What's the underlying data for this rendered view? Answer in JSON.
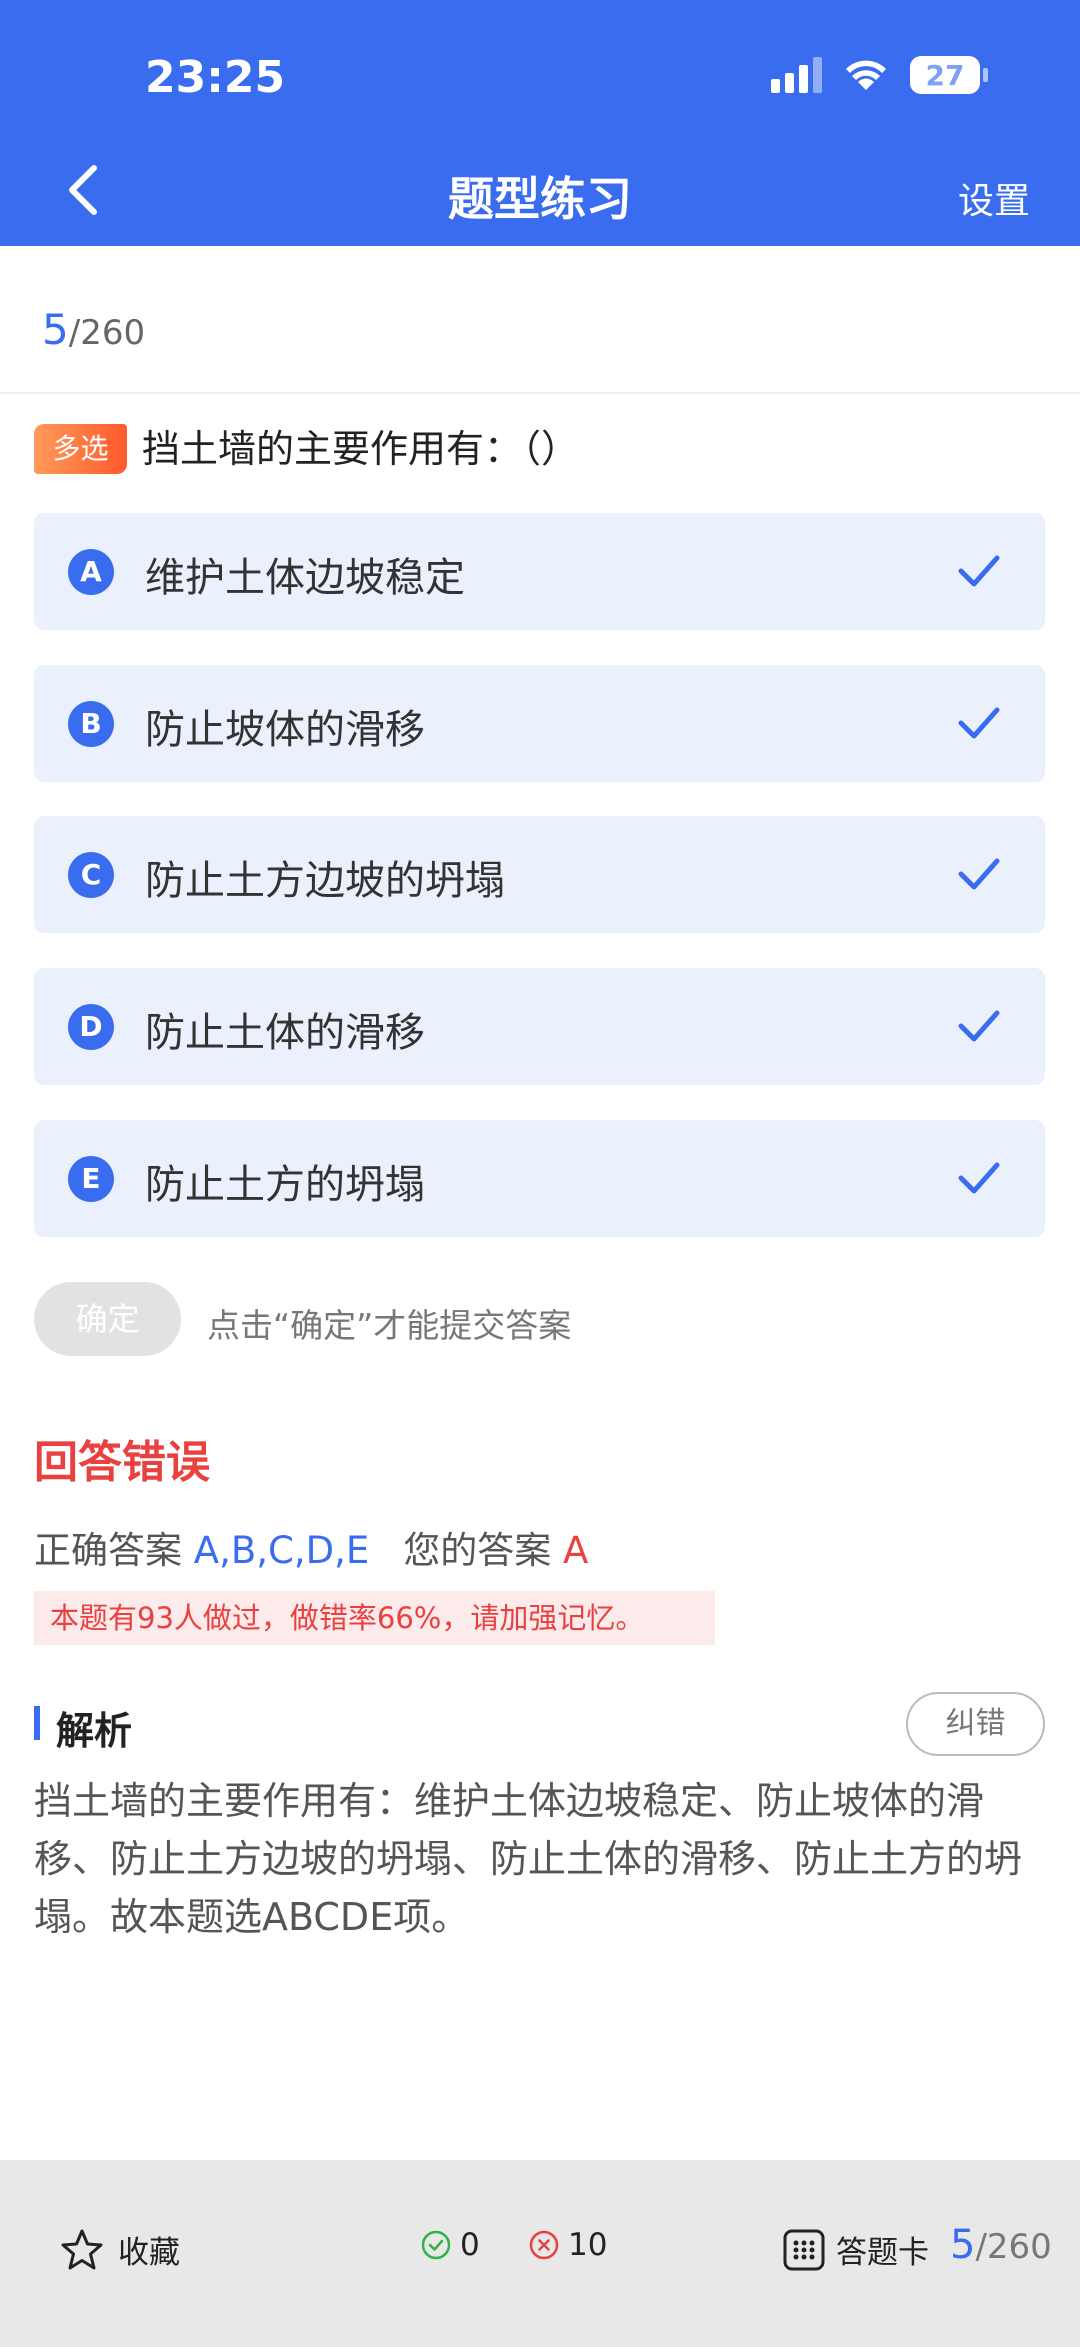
{
  "status": {
    "time": "23:25",
    "battery": "27"
  },
  "nav": {
    "title": "题型练习",
    "settings": "设置"
  },
  "progress": {
    "current": "5",
    "total": "/260"
  },
  "question": {
    "type": "多选",
    "text": "挡土墙的主要作用有：（）",
    "options": [
      {
        "letter": "A",
        "text": "维护土体边坡稳定"
      },
      {
        "letter": "B",
        "text": "防止坡体的滑移"
      },
      {
        "letter": "C",
        "text": "防止土方边坡的坍塌"
      },
      {
        "letter": "D",
        "text": "防止土体的滑移"
      },
      {
        "letter": "E",
        "text": "防止土方的坍塌"
      }
    ]
  },
  "confirm": {
    "label": "确定",
    "hint": "点击“确定”才能提交答案"
  },
  "result": {
    "title": "回答错误",
    "correct_label": "正确答案",
    "correct_value": "A,B,C,D,E",
    "mine_label": "您的答案",
    "mine_value": "A",
    "stat": "本题有93人做过，做错率66%，请加强记忆。"
  },
  "analysis": {
    "title": "解析",
    "correct_error": "纠错",
    "text": "挡土墙的主要作用有：维护土体边坡稳定、防止坡体的滑移、防止土方边坡的坍塌、防止土体的滑移、防止土方的坍塌。故本题选ABCDE项。"
  },
  "bottom": {
    "favorite": "收藏",
    "right_count": "0",
    "wrong_count": "10",
    "answer_card": "答题卡",
    "current": "5",
    "total": "/260"
  },
  "colors": {
    "accent": "#3a6cf0",
    "error": "#e94040",
    "correct": "#2fb344"
  }
}
